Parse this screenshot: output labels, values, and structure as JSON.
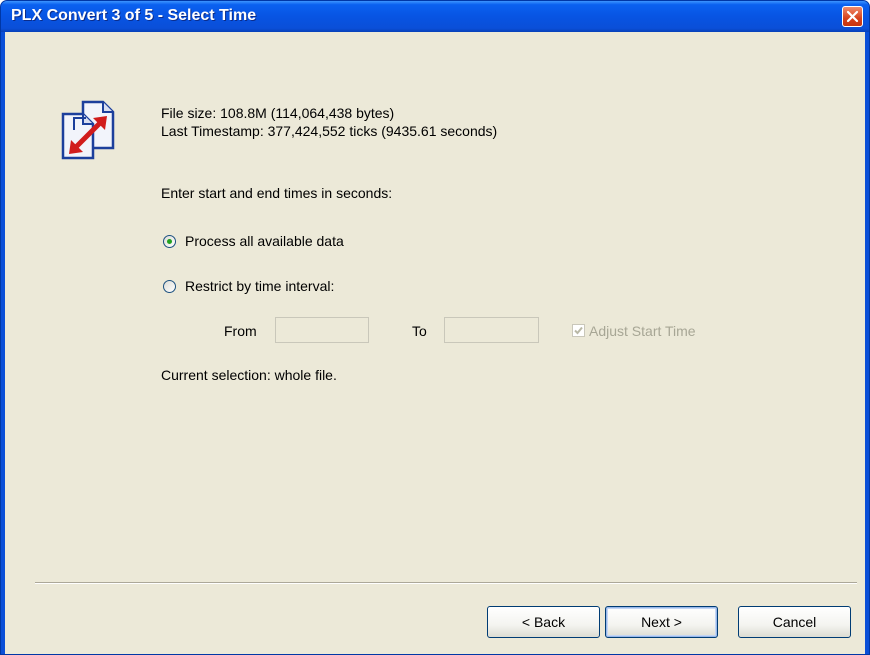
{
  "window": {
    "title": "PLX Convert 3 of 5 - Select Time"
  },
  "info": {
    "file_size": "File size: 108.8M (114,064,438 bytes)",
    "last_timestamp": "Last Timestamp: 377,424,552 ticks (9435.61 seconds)"
  },
  "prompt": "Enter start and end times in seconds:",
  "options": {
    "all_data": {
      "label": "Process all available data",
      "selected": true
    },
    "restrict": {
      "label": "Restrict by  time interval:",
      "selected": false
    }
  },
  "interval": {
    "from_label": "From",
    "from_value": "",
    "to_label": "To",
    "to_value": "",
    "adjust_label": "Adjust Start Time",
    "adjust_checked": true
  },
  "current_selection": "Current selection: whole file.",
  "buttons": {
    "back": "< Back",
    "next": "Next >",
    "cancel": "Cancel"
  },
  "colors": {
    "titlebar": "#0a4fd8",
    "client": "#ece9d8",
    "close": "#d6411c",
    "radio_dot": "#21a121"
  }
}
